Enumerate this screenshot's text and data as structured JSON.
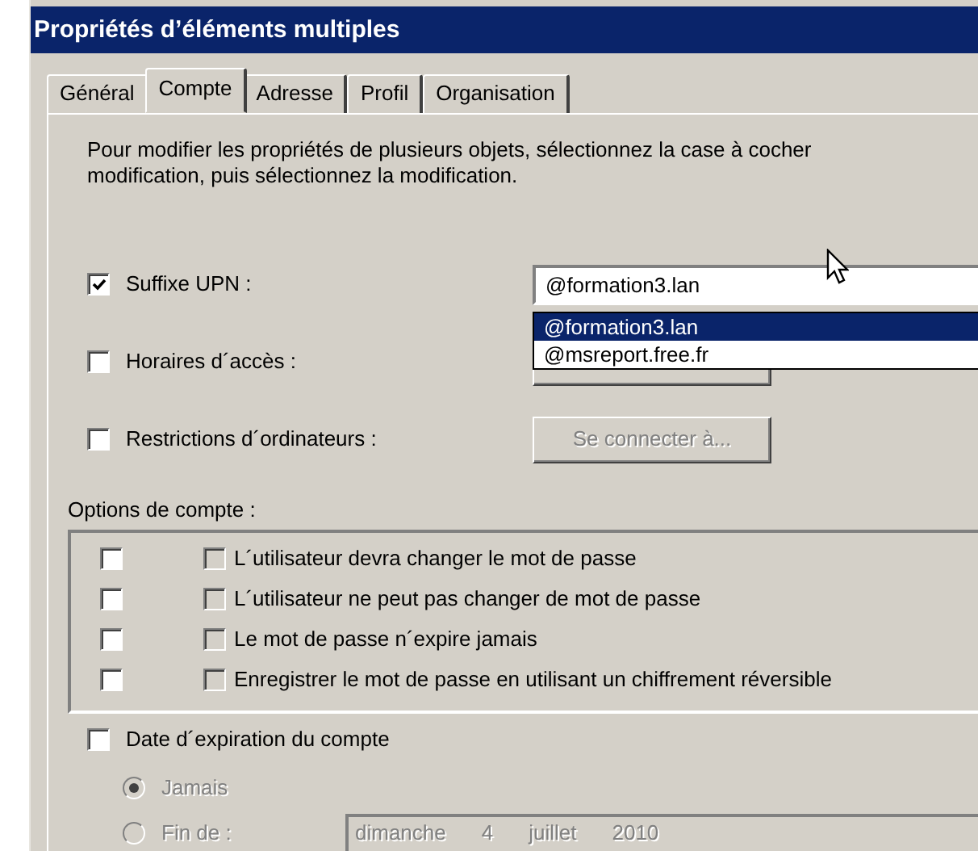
{
  "window": {
    "title": "Propriétés d’éléments multiples"
  },
  "tabs": [
    {
      "label": "Général",
      "selected": false
    },
    {
      "label": "Compte",
      "selected": true
    },
    {
      "label": "Adresse",
      "selected": false
    },
    {
      "label": "Profil",
      "selected": false
    },
    {
      "label": "Organisation",
      "selected": false
    }
  ],
  "intro": [
    "Pour modifier les propriétés de plusieurs objets, sélectionnez la case à cocher",
    "modification, puis sélectionnez la modification."
  ],
  "settings": [
    {
      "kind": "combo",
      "label": "Suffixe UPN :",
      "checked": true,
      "value": "@formation3.lan",
      "expanded": true,
      "options": [
        {
          "label": "@formation3.lan",
          "selected": true
        },
        {
          "label": "@msreport.free.fr",
          "selected": false
        }
      ]
    },
    {
      "kind": "button",
      "label": "Horaires d´accès :",
      "checked": false
    },
    {
      "kind": "button",
      "label": "Restrictions d´ordinateurs :",
      "checked": false,
      "button": "Se connecter à...",
      "disabled": true
    }
  ],
  "account_options": {
    "label": "Options de compte :",
    "items": [
      {
        "apply": false,
        "label": "L´utilisateur devra changer le mot de passe",
        "checked": false,
        "disabled": true
      },
      {
        "apply": false,
        "label": "L´utilisateur ne peut pas changer de mot de passe",
        "checked": false,
        "disabled": true
      },
      {
        "apply": false,
        "label": "Le mot de passe n´expire jamais",
        "checked": false,
        "disabled": true
      },
      {
        "apply": false,
        "label": "Enregistrer le mot de passe en utilisant un chiffrement réversible",
        "checked": false,
        "disabled": true
      }
    ]
  },
  "expiration": {
    "label": "Date d´expiration du compte",
    "checked": false,
    "radios": [
      {
        "label": "Jamais",
        "selected": true,
        "disabled": true
      },
      {
        "label": "Fin de :",
        "selected": false,
        "disabled": true
      }
    ],
    "date": [
      "dimanche",
      "4",
      "juillet",
      "2010"
    ]
  }
}
